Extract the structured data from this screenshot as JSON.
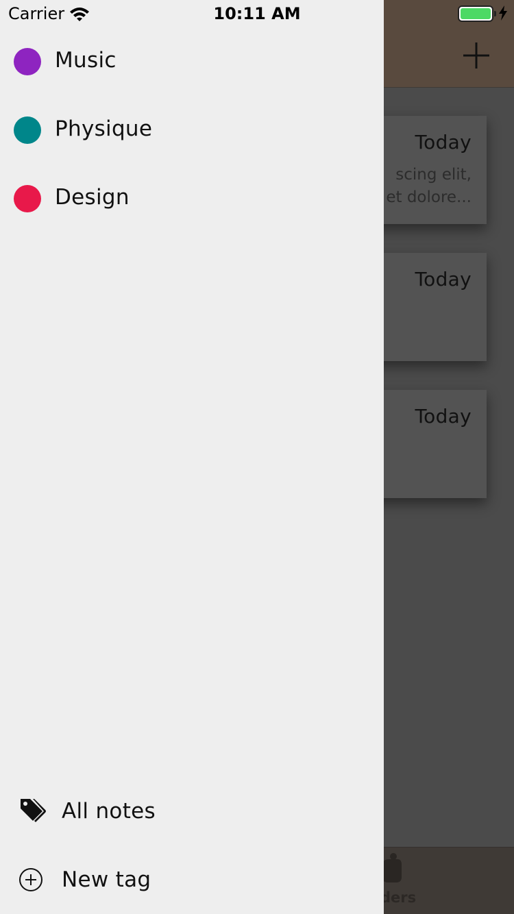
{
  "status_bar": {
    "carrier": "Carrier",
    "time": "10:11 AM",
    "battery_percent": 100
  },
  "drawer": {
    "tags": [
      {
        "label": "Music",
        "color": "#8e24c0"
      },
      {
        "label": "Physique",
        "color": "#00868a"
      },
      {
        "label": "Design",
        "color": "#e8194a"
      }
    ],
    "all_notes_label": "All notes",
    "all_notes_icon": "tags-icon",
    "new_tag_label": "New tag",
    "new_tag_icon": "plus-circle-icon"
  },
  "background_app": {
    "add_icon": "plus-icon",
    "cards": [
      {
        "date": "Today",
        "snippet_line1": "scing elit,",
        "snippet_line2": "et dolore..."
      },
      {
        "date": "Today",
        "snippet_line1": "",
        "snippet_line2": ""
      },
      {
        "date": "Today",
        "snippet_line1": "",
        "snippet_line2": ""
      }
    ],
    "tab_label": "nders",
    "tab_icon": "reminders-icon"
  }
}
